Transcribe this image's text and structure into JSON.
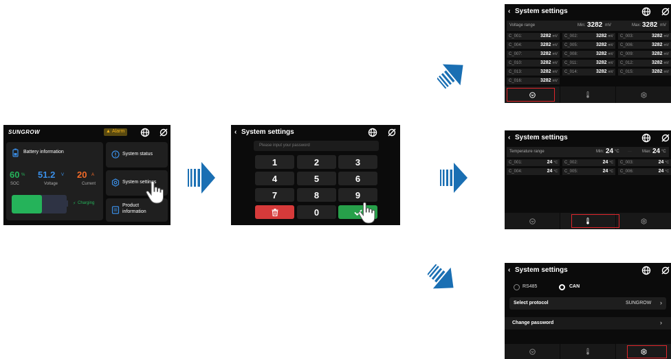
{
  "colors": {
    "accent_green": "#25b35a",
    "accent_blue": "#3a8ee6",
    "accent_orange": "#f26a28",
    "danger": "#d63a3a",
    "confirm": "#27a04a",
    "arrow_blue": "#1a6fb3",
    "highlight": "#e0262b"
  },
  "main": {
    "brand": "SUNGROW",
    "alarm_label": "Alarm",
    "battery_info_label": "Battery information",
    "soc_value": "60",
    "soc_unit": "%",
    "soc_label": "SOC",
    "voltage_value": "51.2",
    "voltage_unit": "V",
    "voltage_label": "Voltage",
    "current_value": "20",
    "current_unit": "A",
    "current_label": "Current",
    "charging_label": "Charging",
    "charge_level": 0.55,
    "menu": {
      "status": "System status",
      "settings": "System settings",
      "product_line1": "Product",
      "product_line2": "information"
    }
  },
  "password": {
    "title": "System settings",
    "placeholder": "Please input your password",
    "keys": [
      "1",
      "2",
      "3",
      "4",
      "5",
      "6",
      "7",
      "8",
      "9"
    ],
    "zero": "0"
  },
  "voltage": {
    "title": "System settings",
    "range_label": "Voltage range",
    "min_label": "Min:",
    "min_value": "3282",
    "min_unit": "mV",
    "max_label": "Max:",
    "max_value": "3282",
    "max_unit": "mV",
    "cells": [
      {
        "name": "C_001:",
        "value": "3282",
        "unit": "mV"
      },
      {
        "name": "C_002:",
        "value": "3282",
        "unit": "mV"
      },
      {
        "name": "C_003:",
        "value": "3282",
        "unit": "mV"
      },
      {
        "name": "C_004:",
        "value": "3282",
        "unit": "mV"
      },
      {
        "name": "C_005:",
        "value": "3282",
        "unit": "mV"
      },
      {
        "name": "C_006:",
        "value": "3282",
        "unit": "mV"
      },
      {
        "name": "C_007:",
        "value": "3282",
        "unit": "mV"
      },
      {
        "name": "C_008:",
        "value": "3282",
        "unit": "mV"
      },
      {
        "name": "C_009:",
        "value": "3282",
        "unit": "mV"
      },
      {
        "name": "C_010:",
        "value": "3282",
        "unit": "mV"
      },
      {
        "name": "C_011:",
        "value": "3282",
        "unit": "mV"
      },
      {
        "name": "C_012:",
        "value": "3282",
        "unit": "mV"
      },
      {
        "name": "C_013:",
        "value": "3282",
        "unit": "mV"
      },
      {
        "name": "C_014:",
        "value": "3282",
        "unit": "mV"
      },
      {
        "name": "C_015:",
        "value": "3282",
        "unit": "mV"
      },
      {
        "name": "C_016:",
        "value": "3282",
        "unit": "mV"
      }
    ]
  },
  "temperature": {
    "title": "System settings",
    "range_label": "Temperature range",
    "min_label": "Min:",
    "min_value": "24",
    "min_unit": "°C",
    "dots": "···",
    "max_label": "Max:",
    "max_value": "24",
    "max_unit": "°C",
    "cells": [
      {
        "name": "C_001:",
        "value": "24",
        "unit": "°C"
      },
      {
        "name": "C_002:",
        "value": "24",
        "unit": "°C"
      },
      {
        "name": "C_003:",
        "value": "24",
        "unit": "°C"
      },
      {
        "name": "C_004:",
        "value": "24",
        "unit": "°C"
      },
      {
        "name": "C_005:",
        "value": "24",
        "unit": "°C"
      },
      {
        "name": "C_006:",
        "value": "24",
        "unit": "°C"
      }
    ]
  },
  "settings": {
    "title": "System settings",
    "rs485": "RS485",
    "can": "CAN",
    "select_protocol": "Select protocol",
    "protocol_value": "SUNGROW",
    "change_password": "Change password"
  }
}
